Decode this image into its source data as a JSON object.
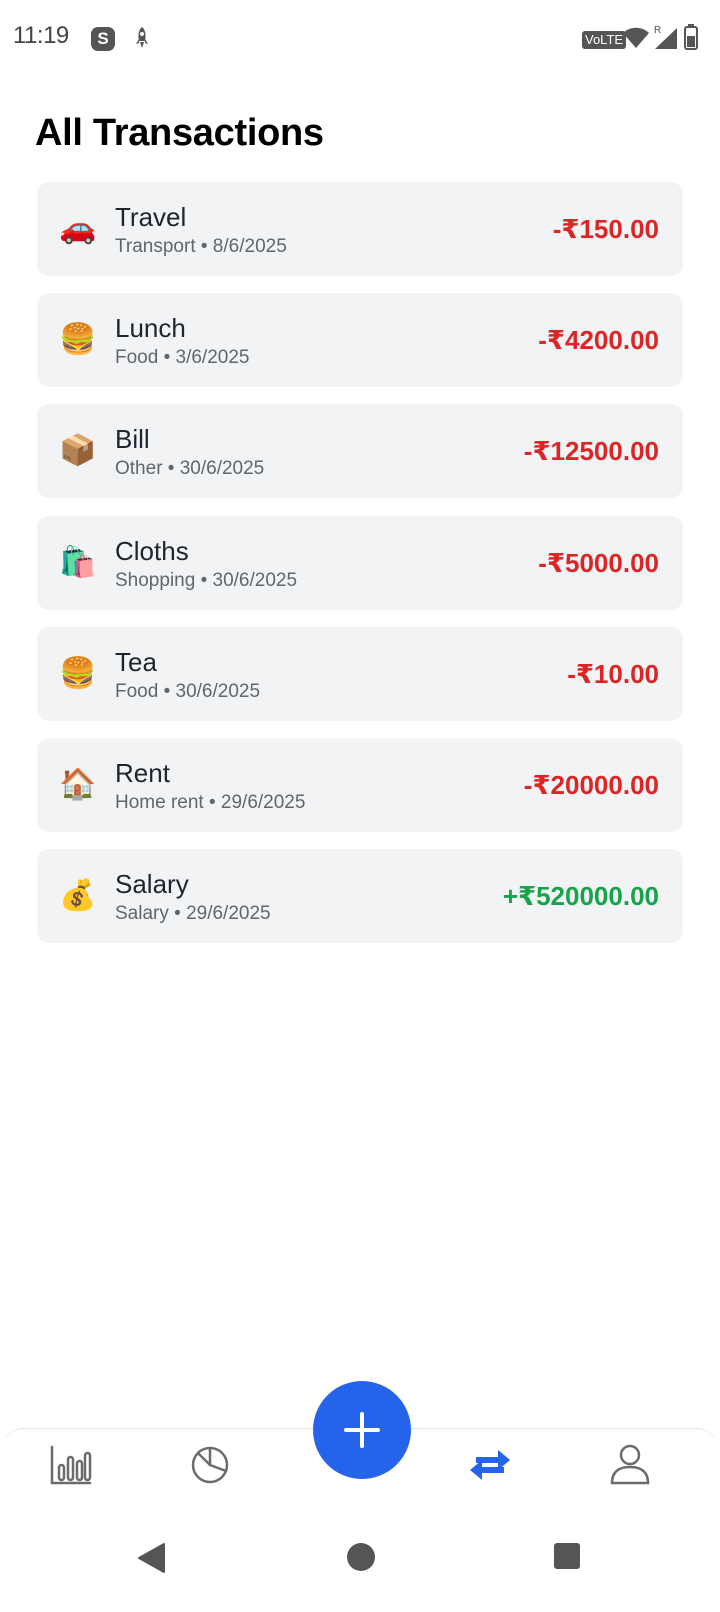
{
  "status_bar": {
    "time": "11:19",
    "skype_badge": "S",
    "network_label": "VoLTE",
    "roaming_label": "R"
  },
  "page": {
    "title": "All Transactions"
  },
  "transactions": [
    {
      "icon": "car-icon",
      "emoji": "🚗",
      "title": "Travel",
      "meta": "Transport • 8/6/2025",
      "amount": "-₹150.00",
      "type": "expense"
    },
    {
      "icon": "burger-icon",
      "emoji": "🍔",
      "title": "Lunch",
      "meta": "Food • 3/6/2025",
      "amount": "-₹4200.00",
      "type": "expense"
    },
    {
      "icon": "package-icon",
      "emoji": "📦",
      "title": "Bill",
      "meta": "Other • 30/6/2025",
      "amount": "-₹12500.00",
      "type": "expense"
    },
    {
      "icon": "shopping-bags-icon",
      "emoji": "🛍️",
      "title": "Cloths",
      "meta": "Shopping • 30/6/2025",
      "amount": "-₹5000.00",
      "type": "expense"
    },
    {
      "icon": "burger-icon",
      "emoji": "🍔",
      "title": "Tea",
      "meta": "Food • 30/6/2025",
      "amount": "-₹10.00",
      "type": "expense"
    },
    {
      "icon": "house-icon",
      "emoji": "🏠",
      "title": "Rent",
      "meta": "Home rent • 29/6/2025",
      "amount": "-₹20000.00",
      "type": "expense"
    },
    {
      "icon": "money-bag-icon",
      "emoji": "💰",
      "title": "Salary",
      "meta": "Salary • 29/6/2025",
      "amount": "+₹520000.00",
      "type": "income"
    }
  ],
  "bottom_nav": {
    "items": [
      "bar-chart-icon",
      "pie-chart-icon",
      "add-icon",
      "transfer-icon",
      "user-icon"
    ],
    "active": "transfer-icon"
  },
  "colors": {
    "accent": "#2563eb",
    "expense": "#dc2626",
    "income": "#16a34a",
    "card": "#f2f3f5"
  }
}
